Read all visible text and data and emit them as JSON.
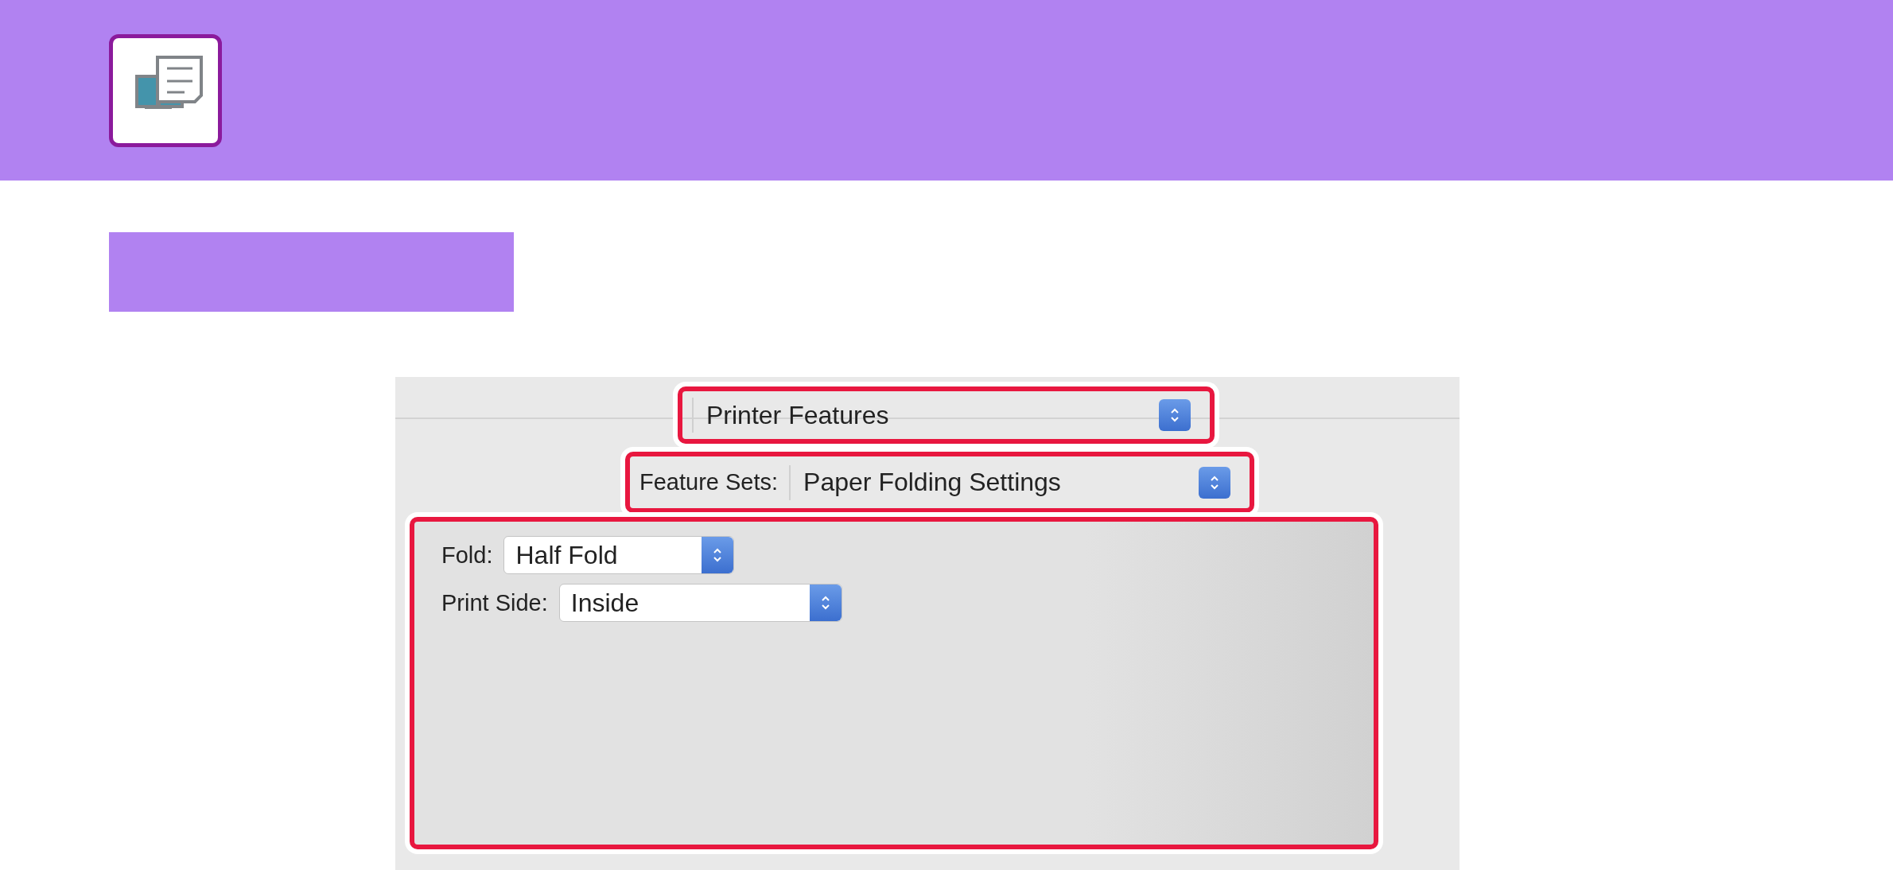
{
  "dialog": {
    "preset_popup": "Printer Features",
    "feature_sets": {
      "label": "Feature Sets:",
      "value": "Paper Folding Settings"
    },
    "options": [
      {
        "label": "Fold:",
        "value": "Half Fold"
      },
      {
        "label": "Print Side:",
        "value": "Inside"
      }
    ]
  }
}
